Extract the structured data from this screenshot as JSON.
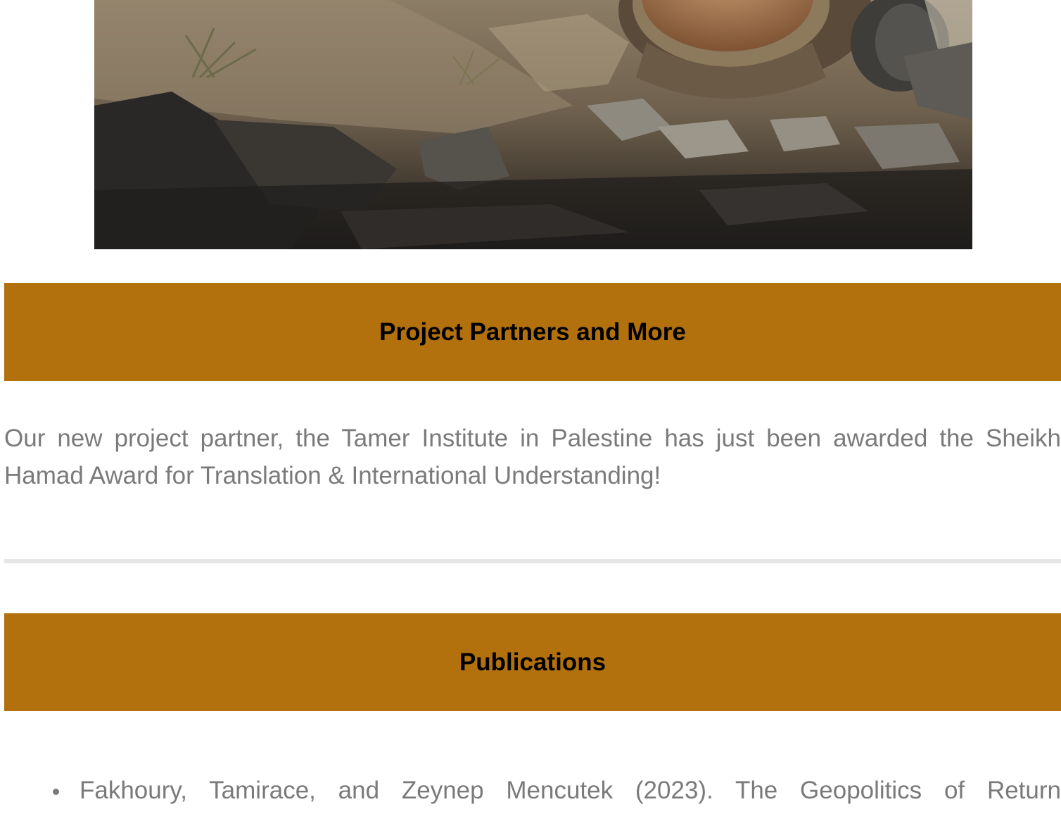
{
  "colors": {
    "banner": "#b3710e",
    "body_text": "#7a7a7a",
    "heading_text": "#000000",
    "divider": "#e6e6e6"
  },
  "hero_image": {
    "icon": "ruined-clock-landscape-image"
  },
  "sections": [
    {
      "heading": "Project Partners and More",
      "paragraph": "Our new project partner, the Tamer Institute in Palestine has just been awarded the Sheikh Hamad Award for Translation & International Understanding!"
    },
    {
      "heading": "Publications",
      "items": [
        "Fakhoury, Tamirace, and Zeynep Mencutek (2023). The Geopolitics of Return"
      ]
    }
  ]
}
